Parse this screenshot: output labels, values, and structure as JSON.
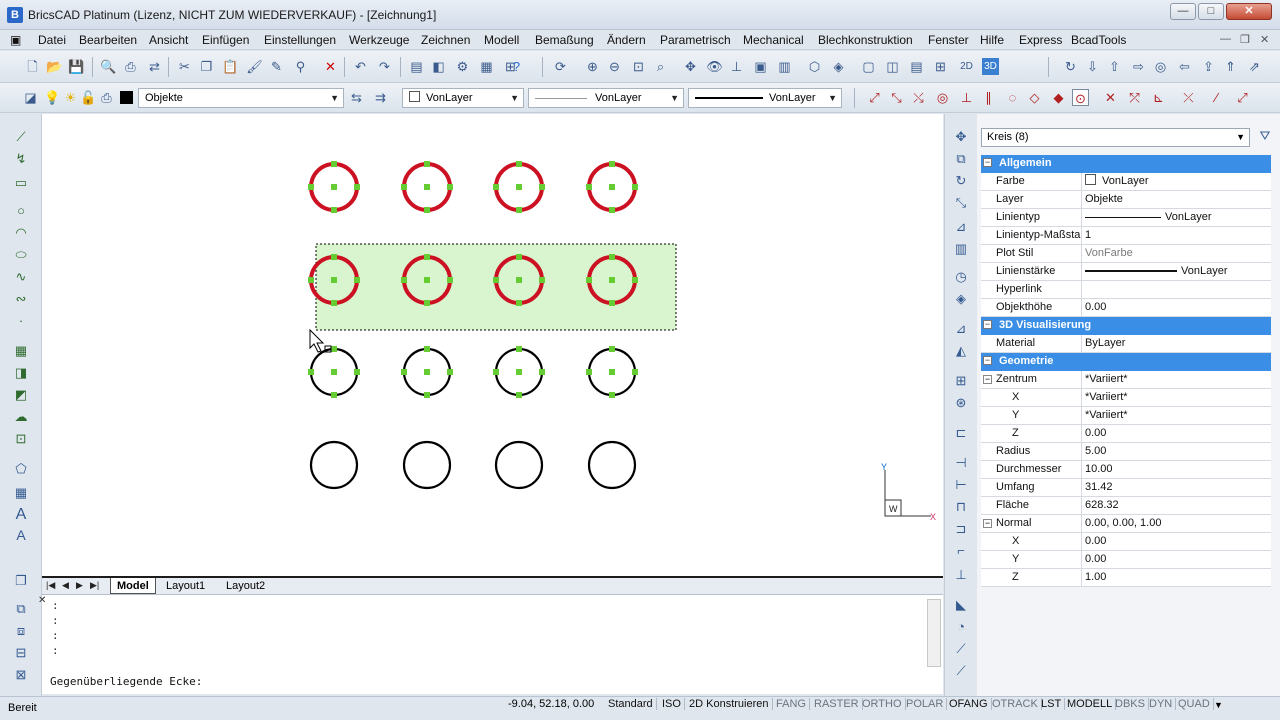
{
  "window": {
    "title": "BricsCAD Platinum (Lizenz, NICHT ZUM WIEDERVERKAUF) - [Zeichnung1]",
    "app_icon": "bricscad-logo-icon",
    "minimize": "—",
    "maximize": "□",
    "close": "✕"
  },
  "menubar": {
    "items": [
      "Datei",
      "Bearbeiten",
      "Ansicht",
      "Einfügen",
      "Einstellungen",
      "Werkzeuge",
      "Zeichnen",
      "Modell",
      "Bemaßung",
      "Ändern",
      "Parametrisch",
      "Mechanical",
      "Blechkonstruktion",
      "Fenster",
      "Hilfe",
      "Express",
      "BcadTools"
    ],
    "mdi_minimize": "—",
    "mdi_restore": "❐",
    "mdi_close": "✕"
  },
  "properties_toolbar": {
    "layer_value": "Objekte",
    "color_value": "VonLayer",
    "linetype_value": "VonLayer",
    "lineweight_value": "VonLayer"
  },
  "layout_tabs": {
    "tabs": [
      "Model",
      "Layout1",
      "Layout2"
    ],
    "active": "Model"
  },
  "command": {
    "history": [
      ":",
      ":",
      ":",
      ":"
    ],
    "prompt": "Gegenüberliegende Ecke:"
  },
  "ucs": {
    "x_label": "X",
    "y_label": "Y",
    "w_label": "W"
  },
  "properties_panel": {
    "selection": "Kreis (8)",
    "categories": [
      {
        "name": "Allgemein",
        "rows": [
          {
            "name": "Farbe",
            "value": "VonLayer"
          },
          {
            "name": "Layer",
            "value": "Objekte"
          },
          {
            "name": "Linientyp",
            "value": "VonLayer"
          },
          {
            "name": "Linientyp-Maßstab",
            "value": "1"
          },
          {
            "name": "Plot Stil",
            "value": "VonFarbe"
          },
          {
            "name": "Linienstärke",
            "value": "VonLayer"
          },
          {
            "name": "Hyperlink",
            "value": ""
          },
          {
            "name": "Objekthöhe",
            "value": "0.00"
          }
        ]
      },
      {
        "name": "3D Visualisierung",
        "rows": [
          {
            "name": "Material",
            "value": "ByLayer"
          }
        ]
      },
      {
        "name": "Geometrie",
        "rows": [
          {
            "name": "Zentrum",
            "value": "*Variiert*"
          },
          {
            "name": "X",
            "value": "*Variiert*"
          },
          {
            "name": "Y",
            "value": "*Variiert*"
          },
          {
            "name": "Z",
            "value": "0.00"
          },
          {
            "name": "Radius",
            "value": "5.00"
          },
          {
            "name": "Durchmesser",
            "value": "10.00"
          },
          {
            "name": "Umfang",
            "value": "31.42"
          },
          {
            "name": "Fläche",
            "value": "628.32"
          },
          {
            "name": "Normal",
            "value": "0.00, 0.00, 1.00"
          },
          {
            "name": "X",
            "value": "0.00"
          },
          {
            "name": "Y",
            "value": "0.00"
          },
          {
            "name": "Z",
            "value": "1.00"
          }
        ]
      }
    ]
  },
  "statusbar": {
    "ready": "Bereit",
    "coords": "-9.04, 52.18, 0.00",
    "items": [
      "Standard",
      "ISO",
      "2D Konstruieren",
      "FANG",
      "RASTER",
      "ORTHO",
      "POLAR",
      "OFANG",
      "OTRACK",
      "LST",
      "MODELL",
      "DBKS",
      "DYN",
      "QUAD"
    ],
    "on_items": [
      "Standard",
      "ISO",
      "2D Konstruieren",
      "OFANG",
      "LST",
      "MODELL"
    ]
  },
  "colors": {
    "selected_circle": "#cc1122",
    "unselected_circle": "#000000",
    "grip": "#66cc33",
    "window_selection_fill": "#d9f5d0",
    "category_header": "#3b8ee6"
  }
}
